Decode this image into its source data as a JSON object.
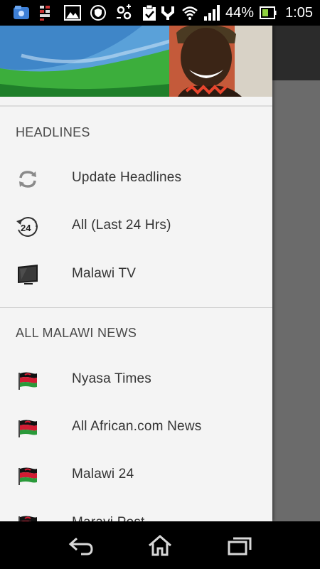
{
  "status_bar": {
    "battery_percent": "44%",
    "time": "1:05",
    "left_icons": [
      "app-icon",
      "signal-app-icon",
      "gallery-icon",
      "shield-icon",
      "sync-icon",
      "clipboard-check-icon"
    ],
    "right_icons": [
      "usb-debug-icon",
      "wifi-icon",
      "cell-signal-icon",
      "battery-icon"
    ]
  },
  "drawer": {
    "sections": [
      {
        "title": "HEADLINES",
        "items": [
          {
            "label": "Update Headlines",
            "icon": "refresh-icon"
          },
          {
            "label": "All (Last 24 Hrs)",
            "icon": "24-hours-icon"
          },
          {
            "label": "Malawi TV",
            "icon": "tv-icon"
          }
        ]
      },
      {
        "title": "ALL MALAWI NEWS",
        "items": [
          {
            "label": "Nyasa Times",
            "icon": "malawi-flag-icon"
          },
          {
            "label": "All African.com News",
            "icon": "malawi-flag-icon"
          },
          {
            "label": "Malawi 24",
            "icon": "malawi-flag-icon"
          },
          {
            "label": "Maravi Post",
            "icon": "malawi-flag-icon"
          }
        ]
      }
    ]
  },
  "nav_bar": {
    "buttons": [
      "back-icon",
      "home-icon",
      "recent-apps-icon"
    ]
  },
  "colors": {
    "drawer_bg": "#f4f4f4",
    "scrim": "#6b6b6b",
    "text": "#333333",
    "header_text": "#4a4a4a"
  }
}
